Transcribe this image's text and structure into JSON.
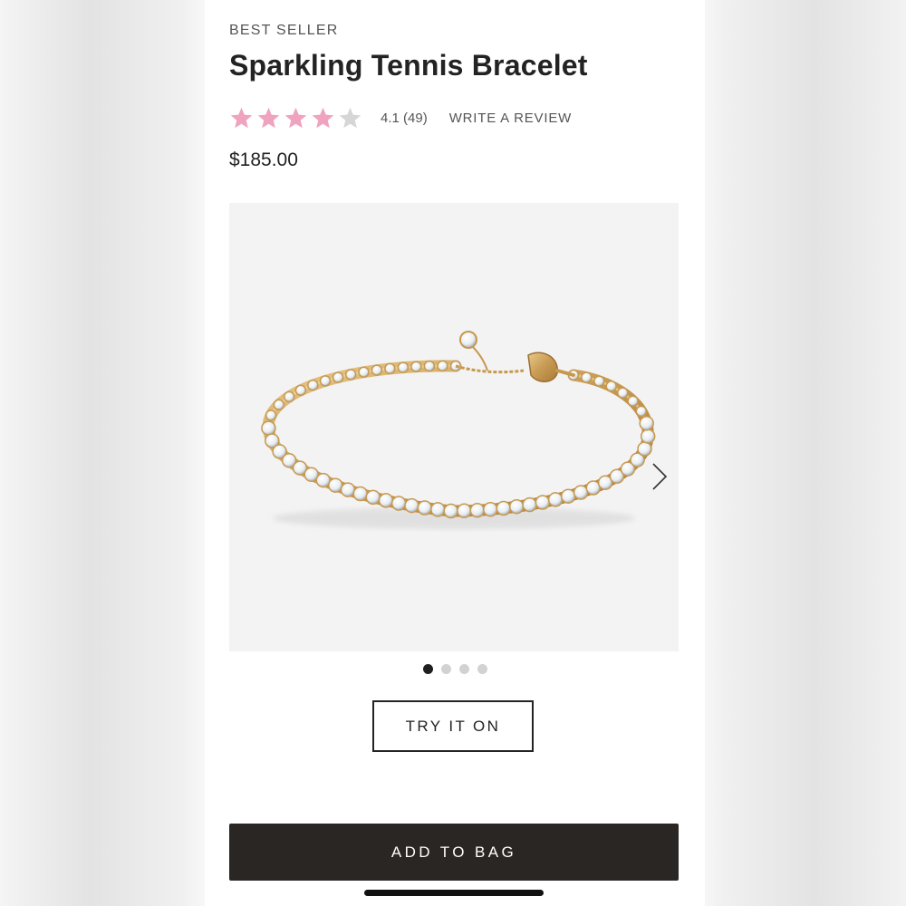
{
  "product": {
    "badge": "BEST SELLER",
    "name": "Sparkling Tennis Bracelet",
    "rating": 4.1,
    "rating_max": 5,
    "rating_text": "4.1 (49)",
    "review_link": "WRITE A REVIEW",
    "price": "$185.00"
  },
  "gallery": {
    "image_count": 4,
    "active_index": 0
  },
  "actions": {
    "try_on_label": "TRY IT ON",
    "add_to_bag_label": "ADD TO BAG"
  },
  "colors": {
    "star_filled": "#f0a3bf",
    "star_empty": "#d6d6d6",
    "primary_button": "#292623",
    "gallery_background": "#f3f3f3"
  },
  "icons": {
    "star": "star-icon",
    "next": "chevron-right-icon"
  }
}
